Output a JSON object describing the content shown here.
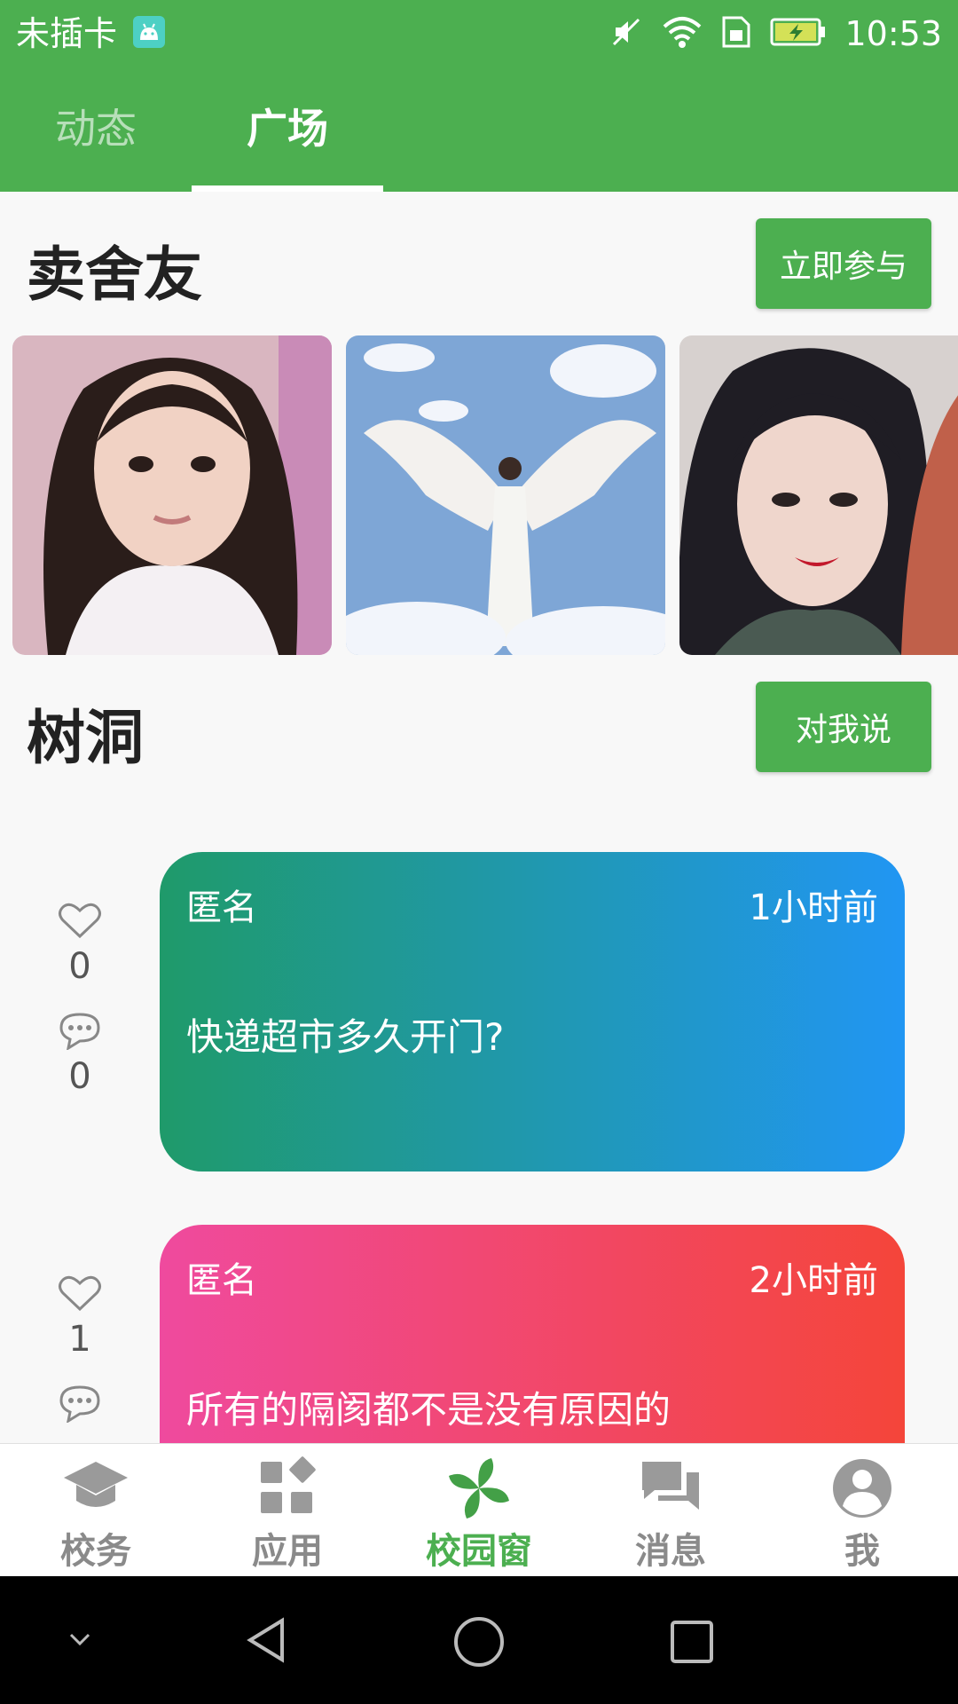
{
  "status_bar": {
    "carrier": "未插卡",
    "time": "10:53"
  },
  "tabs": [
    {
      "label": "动态",
      "active": false
    },
    {
      "label": "广场",
      "active": true
    }
  ],
  "roommate_section": {
    "title": "卖舍友",
    "action_label": "立即参与"
  },
  "treehole_section": {
    "title": "树洞",
    "action_label": "对我说"
  },
  "posts": [
    {
      "author": "匿名",
      "time": "1小时前",
      "content": "快递超市多久开门?",
      "likes": "0",
      "comments": "0",
      "gradient": [
        "#1f9a6a",
        "#2196f3"
      ]
    },
    {
      "author": "匿名",
      "time": "2小时前",
      "content": "所有的隔阂都不是没有原因的",
      "likes": "1",
      "gradient": [
        "#ef4a9e",
        "#f4453a"
      ]
    }
  ],
  "bottom_nav": [
    {
      "label": "校务",
      "icon": "graduation-cap-icon",
      "active": false
    },
    {
      "label": "应用",
      "icon": "apps-grid-icon",
      "active": false
    },
    {
      "label": "校园窗",
      "icon": "pinwheel-icon",
      "active": true
    },
    {
      "label": "消息",
      "icon": "chat-bubbles-icon",
      "active": false
    },
    {
      "label": "我",
      "icon": "account-circle-icon",
      "active": false
    }
  ],
  "colors": {
    "primary": "#4caf50",
    "inactive": "#8a8a8a"
  }
}
